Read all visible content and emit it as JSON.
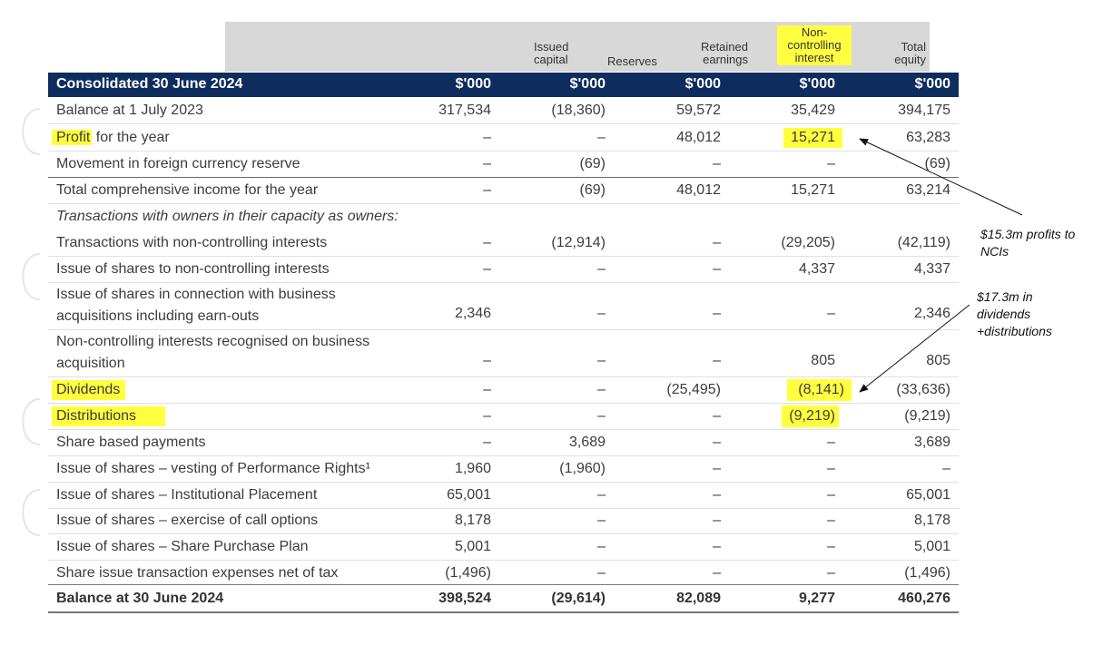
{
  "headers": {
    "issued_capital": [
      "Issued",
      "capital"
    ],
    "reserves": "Reserves",
    "retained_earnings": [
      "Retained",
      "earnings"
    ],
    "nci": [
      "Non-",
      "controlling",
      "interest"
    ],
    "total_equity": [
      "Total",
      "equity"
    ]
  },
  "title_row": {
    "label": "Consolidated 30 June 2024",
    "units": [
      "$'000",
      "$'000",
      "$'000",
      "$'000",
      "$'000"
    ]
  },
  "rows": [
    {
      "label": "Balance at 1 July 2023",
      "values": [
        "317,534",
        "(18,360)",
        "59,572",
        "35,429",
        "394,175"
      ]
    },
    {
      "label_hl": "Profit",
      "label_rest": " for the year",
      "values": [
        "–",
        "–",
        "48,012",
        "15,271",
        "63,283"
      ]
    },
    {
      "label": "Movement in foreign currency reserve",
      "values": [
        "–",
        "(69)",
        "–",
        "–",
        "(69)"
      ]
    },
    {
      "label": "Total comprehensive income for the year",
      "values": [
        "–",
        "(69)",
        "48,012",
        "15,271",
        "63,214"
      ]
    },
    {
      "label": "Transactions with owners in their capacity as owners:",
      "values": [
        "",
        "",
        "",
        "",
        ""
      ]
    },
    {
      "label": "Transactions with non-controlling interests",
      "values": [
        "–",
        "(12,914)",
        "–",
        "(29,205)",
        "(42,119)"
      ]
    },
    {
      "label": "Issue of shares to non-controlling interests",
      "values": [
        "–",
        "–",
        "–",
        "4,337",
        "4,337"
      ]
    },
    {
      "label": [
        "Issue of shares in connection with business",
        "acquisitions including earn-outs"
      ],
      "values": [
        "2,346",
        "–",
        "–",
        "–",
        "2,346"
      ]
    },
    {
      "label": [
        "Non-controlling interests recognised on business",
        "acquisition"
      ],
      "values": [
        "–",
        "–",
        "–",
        "805",
        "805"
      ]
    },
    {
      "label": "Dividends",
      "values": [
        "–",
        "–",
        "(25,495)",
        "(8,141)",
        "(33,636)"
      ]
    },
    {
      "label": "Distributions",
      "values": [
        "–",
        "–",
        "–",
        "(9,219)",
        "(9,219)"
      ]
    },
    {
      "label": "Share based payments",
      "values": [
        "–",
        "3,689",
        "–",
        "–",
        "3,689"
      ]
    },
    {
      "label": "Issue of shares – vesting of Performance Rights¹",
      "values": [
        "1,960",
        "(1,960)",
        "–",
        "–",
        "–"
      ]
    },
    {
      "label": "Issue of shares – Institutional Placement",
      "values": [
        "65,001",
        "–",
        "–",
        "–",
        "65,001"
      ]
    },
    {
      "label": "Issue of shares – exercise of call options",
      "values": [
        "8,178",
        "–",
        "–",
        "–",
        "8,178"
      ]
    },
    {
      "label": "Issue of shares – Share Purchase Plan",
      "values": [
        "5,001",
        "–",
        "–",
        "–",
        "5,001"
      ]
    },
    {
      "label": "Share issue transaction expenses net of tax",
      "values": [
        "(1,496)",
        "–",
        "–",
        "–",
        "(1,496)"
      ]
    },
    {
      "label": "Balance at 30 June 2024",
      "values": [
        "398,524",
        "(29,614)",
        "82,089",
        "9,277",
        "460,276"
      ]
    }
  ],
  "annotations": {
    "profit_note": [
      "$15.3m profits to",
      "NCIs"
    ],
    "dividend_note": [
      "$17.3m in",
      "dividends",
      "+distributions"
    ]
  },
  "colors": {
    "navy": "#0e2d5e",
    "highlight": "#ffff40",
    "header_band": "#d8d8d8"
  }
}
